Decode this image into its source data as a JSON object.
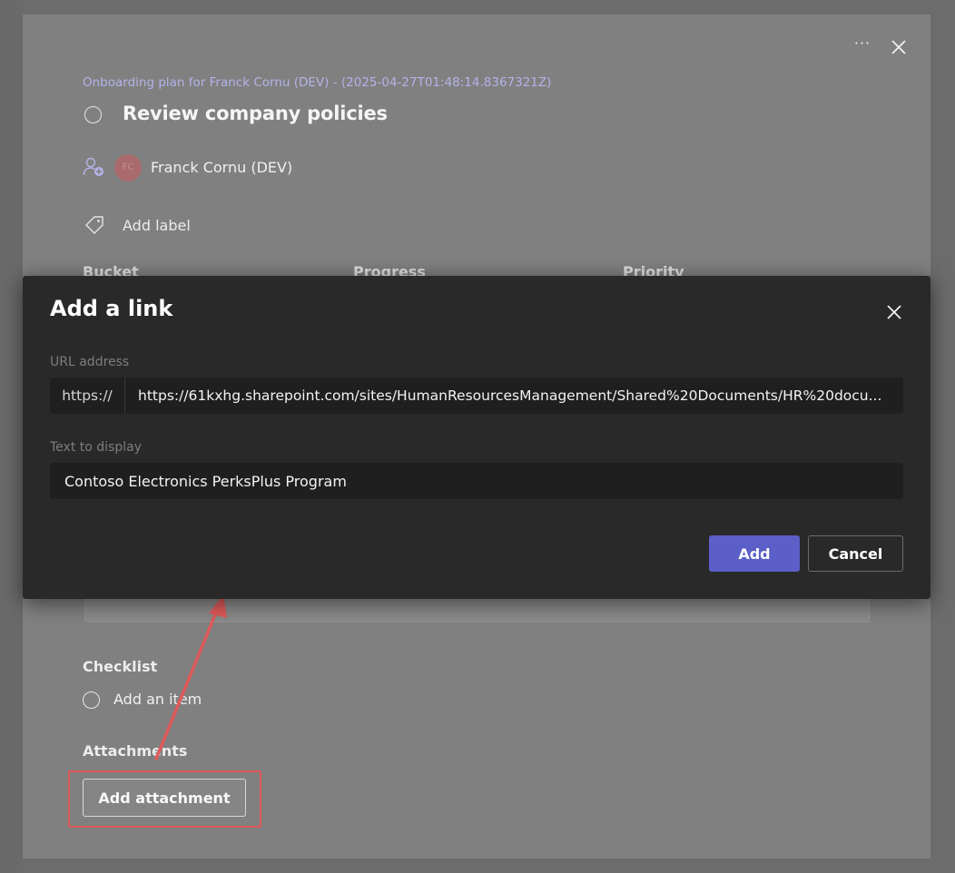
{
  "task_panel": {
    "plan_title": "Onboarding plan for Franck Cornu (DEV) - (2025-04-27T01:48:14.8367321Z)",
    "task_title": "Review company policies",
    "more_options": "···",
    "assignee": {
      "initials": "FC",
      "name": "Franck Cornu (DEV)"
    },
    "add_label": "Add label",
    "columns": {
      "bucket": "Bucket",
      "progress": "Progress",
      "priority": "Priority"
    },
    "checklist": {
      "heading": "Checklist",
      "add_item": "Add an item"
    },
    "attachments": {
      "heading": "Attachments",
      "add_button": "Add attachment"
    }
  },
  "dialog": {
    "title": "Add a link",
    "url_label": "URL address",
    "url_prefix": "https://",
    "url_value": "https://61kxhg.sharepoint.com/sites/HumanResourcesManagement/Shared%20Documents/HR%20docu...",
    "text_label": "Text to display",
    "text_value": "Contoso Electronics PerksPlus Program",
    "add_button": "Add",
    "cancel_button": "Cancel"
  },
  "colors": {
    "accent": "#5b5fc7",
    "annotation": "#e05a5a",
    "plan_title": "#b4b2e8",
    "dialog_bg": "#292929"
  }
}
